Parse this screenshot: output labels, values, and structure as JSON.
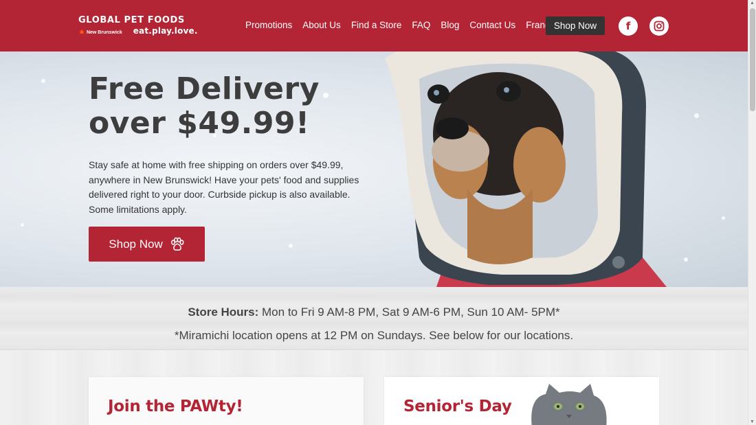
{
  "header": {
    "logo": {
      "brand": "GLOBAL PET FOODS",
      "region": "New Brunswick",
      "tagline": "eat.play.love."
    },
    "nav": [
      "Promotions",
      "About Us",
      "Find a Store",
      "FAQ",
      "Blog",
      "Contact Us",
      "Français"
    ],
    "shop_button": "Shop Now",
    "social": {
      "facebook": "f"
    }
  },
  "hero": {
    "title_line1": "Free Delivery",
    "title_line2": "over $49.99!",
    "body": "Stay safe at home with free shipping on orders over $49.99, anywhere in New Brunswick! Have your pets' food and supplies delivered right to your door. Curbside pickup is also available. Some limitations apply.",
    "button": "Shop Now"
  },
  "hours": {
    "label": "Store Hours:",
    "text": " Mon to Fri 9 AM-8 PM, Sat 9 AM-6 PM, Sun 10 AM- 5PM*",
    "note": "*Miramichi location opens at 12 PM on Sundays. See below for our locations."
  },
  "cards": [
    {
      "title": "Join the PAWty!"
    },
    {
      "title": "Senior's Day"
    }
  ],
  "colors": {
    "brand_red": "#b32434",
    "dark": "#333333"
  },
  "icons": [
    "maple-leaf-icon",
    "facebook-icon",
    "instagram-icon",
    "paw-icon",
    "cat-photo",
    "dog-photo"
  ]
}
